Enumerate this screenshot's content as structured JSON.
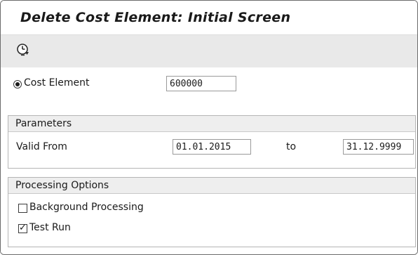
{
  "window": {
    "title": "Delete Cost Element: Initial Screen"
  },
  "toolbar": {
    "execute_icon": "execute-clock-icon"
  },
  "cost_element": {
    "label": "Cost Element",
    "value": "600000",
    "selected": true
  },
  "parameters": {
    "title": "Parameters",
    "valid_from_label": "Valid From",
    "valid_from_value": "01.01.2015",
    "to_label": "to",
    "to_value": "31.12.9999"
  },
  "processing_options": {
    "title": "Processing Options",
    "background_label": "Background Processing",
    "background_checked": false,
    "test_run_label": "Test Run",
    "test_run_checked": true
  }
}
